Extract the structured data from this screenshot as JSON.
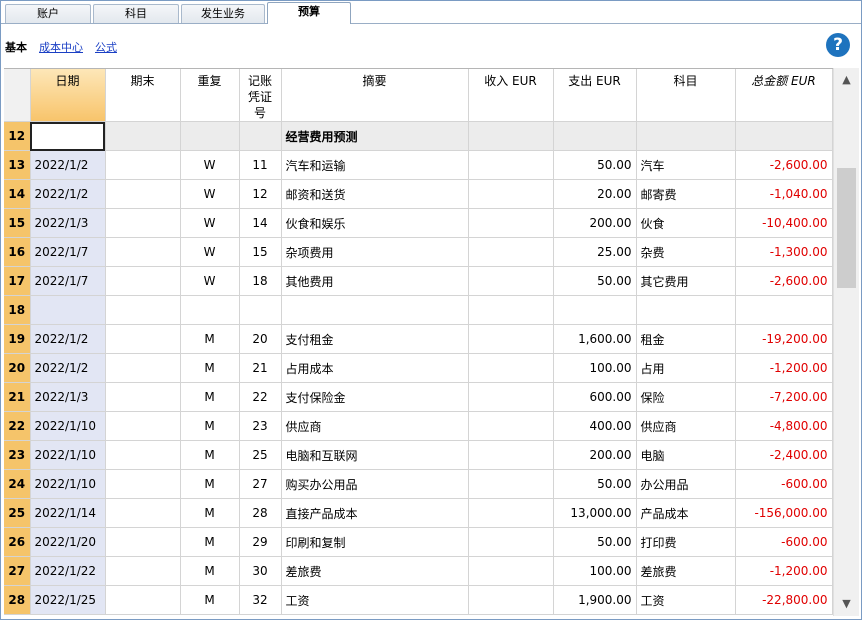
{
  "tabs": [
    {
      "label": "账户",
      "active": false
    },
    {
      "label": "科目",
      "active": false
    },
    {
      "label": "发生业务",
      "active": false
    },
    {
      "label": "预算",
      "active": true
    }
  ],
  "subnav": {
    "basic": "基本",
    "links": [
      "成本中心",
      "公式"
    ],
    "help_icon": "?"
  },
  "columns": {
    "date": "日期",
    "period_end": "期末",
    "repeat": "重复",
    "doc": "记账凭证号",
    "description": "摘要",
    "income": "收入 EUR",
    "expense": "支出 EUR",
    "category": "科目",
    "total": "总金额 EUR"
  },
  "rows": [
    {
      "n": "12",
      "date": "",
      "period_end": "",
      "repeat": "",
      "doc": "",
      "description": "经营费用预测",
      "income": "",
      "expense": "",
      "category": "",
      "total": "",
      "section": true
    },
    {
      "n": "13",
      "date": "2022/1/2",
      "period_end": "",
      "repeat": "W",
      "doc": "11",
      "description": "汽车和运输",
      "income": "",
      "expense": "50.00",
      "category": "汽车",
      "total": "-2,600.00"
    },
    {
      "n": "14",
      "date": "2022/1/2",
      "period_end": "",
      "repeat": "W",
      "doc": "12",
      "description": "邮资和送货",
      "income": "",
      "expense": "20.00",
      "category": "邮寄费",
      "total": "-1,040.00"
    },
    {
      "n": "15",
      "date": "2022/1/3",
      "period_end": "",
      "repeat": "W",
      "doc": "14",
      "description": "伙食和娱乐",
      "income": "",
      "expense": "200.00",
      "category": "伙食",
      "total": "-10,400.00"
    },
    {
      "n": "16",
      "date": "2022/1/7",
      "period_end": "",
      "repeat": "W",
      "doc": "15",
      "description": "杂项费用",
      "income": "",
      "expense": "25.00",
      "category": "杂费",
      "total": "-1,300.00"
    },
    {
      "n": "17",
      "date": "2022/1/7",
      "period_end": "",
      "repeat": "W",
      "doc": "18",
      "description": "其他费用",
      "income": "",
      "expense": "50.00",
      "category": "其它费用",
      "total": "-2,600.00"
    },
    {
      "n": "18",
      "date": "",
      "period_end": "",
      "repeat": "",
      "doc": "",
      "description": "",
      "income": "",
      "expense": "",
      "category": "",
      "total": ""
    },
    {
      "n": "19",
      "date": "2022/1/2",
      "period_end": "",
      "repeat": "M",
      "doc": "20",
      "description": "支付租金",
      "income": "",
      "expense": "1,600.00",
      "category": "租金",
      "total": "-19,200.00"
    },
    {
      "n": "20",
      "date": "2022/1/2",
      "period_end": "",
      "repeat": "M",
      "doc": "21",
      "description": "占用成本",
      "income": "",
      "expense": "100.00",
      "category": "占用",
      "total": "-1,200.00"
    },
    {
      "n": "21",
      "date": "2022/1/3",
      "period_end": "",
      "repeat": "M",
      "doc": "22",
      "description": "支付保险金",
      "income": "",
      "expense": "600.00",
      "category": "保险",
      "total": "-7,200.00"
    },
    {
      "n": "22",
      "date": "2022/1/10",
      "period_end": "",
      "repeat": "M",
      "doc": "23",
      "description": "供应商",
      "income": "",
      "expense": "400.00",
      "category": "供应商",
      "total": "-4,800.00"
    },
    {
      "n": "23",
      "date": "2022/1/10",
      "period_end": "",
      "repeat": "M",
      "doc": "25",
      "description": "电脑和互联网",
      "income": "",
      "expense": "200.00",
      "category": "电脑",
      "total": "-2,400.00"
    },
    {
      "n": "24",
      "date": "2022/1/10",
      "period_end": "",
      "repeat": "M",
      "doc": "27",
      "description": "购买办公用品",
      "income": "",
      "expense": "50.00",
      "category": "办公用品",
      "total": "-600.00"
    },
    {
      "n": "25",
      "date": "2022/1/14",
      "period_end": "",
      "repeat": "M",
      "doc": "28",
      "description": "直接产品成本",
      "income": "",
      "expense": "13,000.00",
      "category": "产品成本",
      "total": "-156,000.00"
    },
    {
      "n": "26",
      "date": "2022/1/20",
      "period_end": "",
      "repeat": "M",
      "doc": "29",
      "description": "印刷和复制",
      "income": "",
      "expense": "50.00",
      "category": "打印费",
      "total": "-600.00"
    },
    {
      "n": "27",
      "date": "2022/1/22",
      "period_end": "",
      "repeat": "M",
      "doc": "30",
      "description": "差旅费",
      "income": "",
      "expense": "100.00",
      "category": "差旅费",
      "total": "-1,200.00"
    },
    {
      "n": "28",
      "date": "2022/1/25",
      "period_end": "",
      "repeat": "M",
      "doc": "32",
      "description": "工资",
      "income": "",
      "expense": "1,900.00",
      "category": "工资",
      "total": "-22,800.00"
    }
  ],
  "colors": {
    "row_header": "#f5c46a",
    "date_column": "#e2e6f4",
    "negative": "#e00000",
    "link": "#1a3fc4",
    "help": "#1e73be"
  }
}
